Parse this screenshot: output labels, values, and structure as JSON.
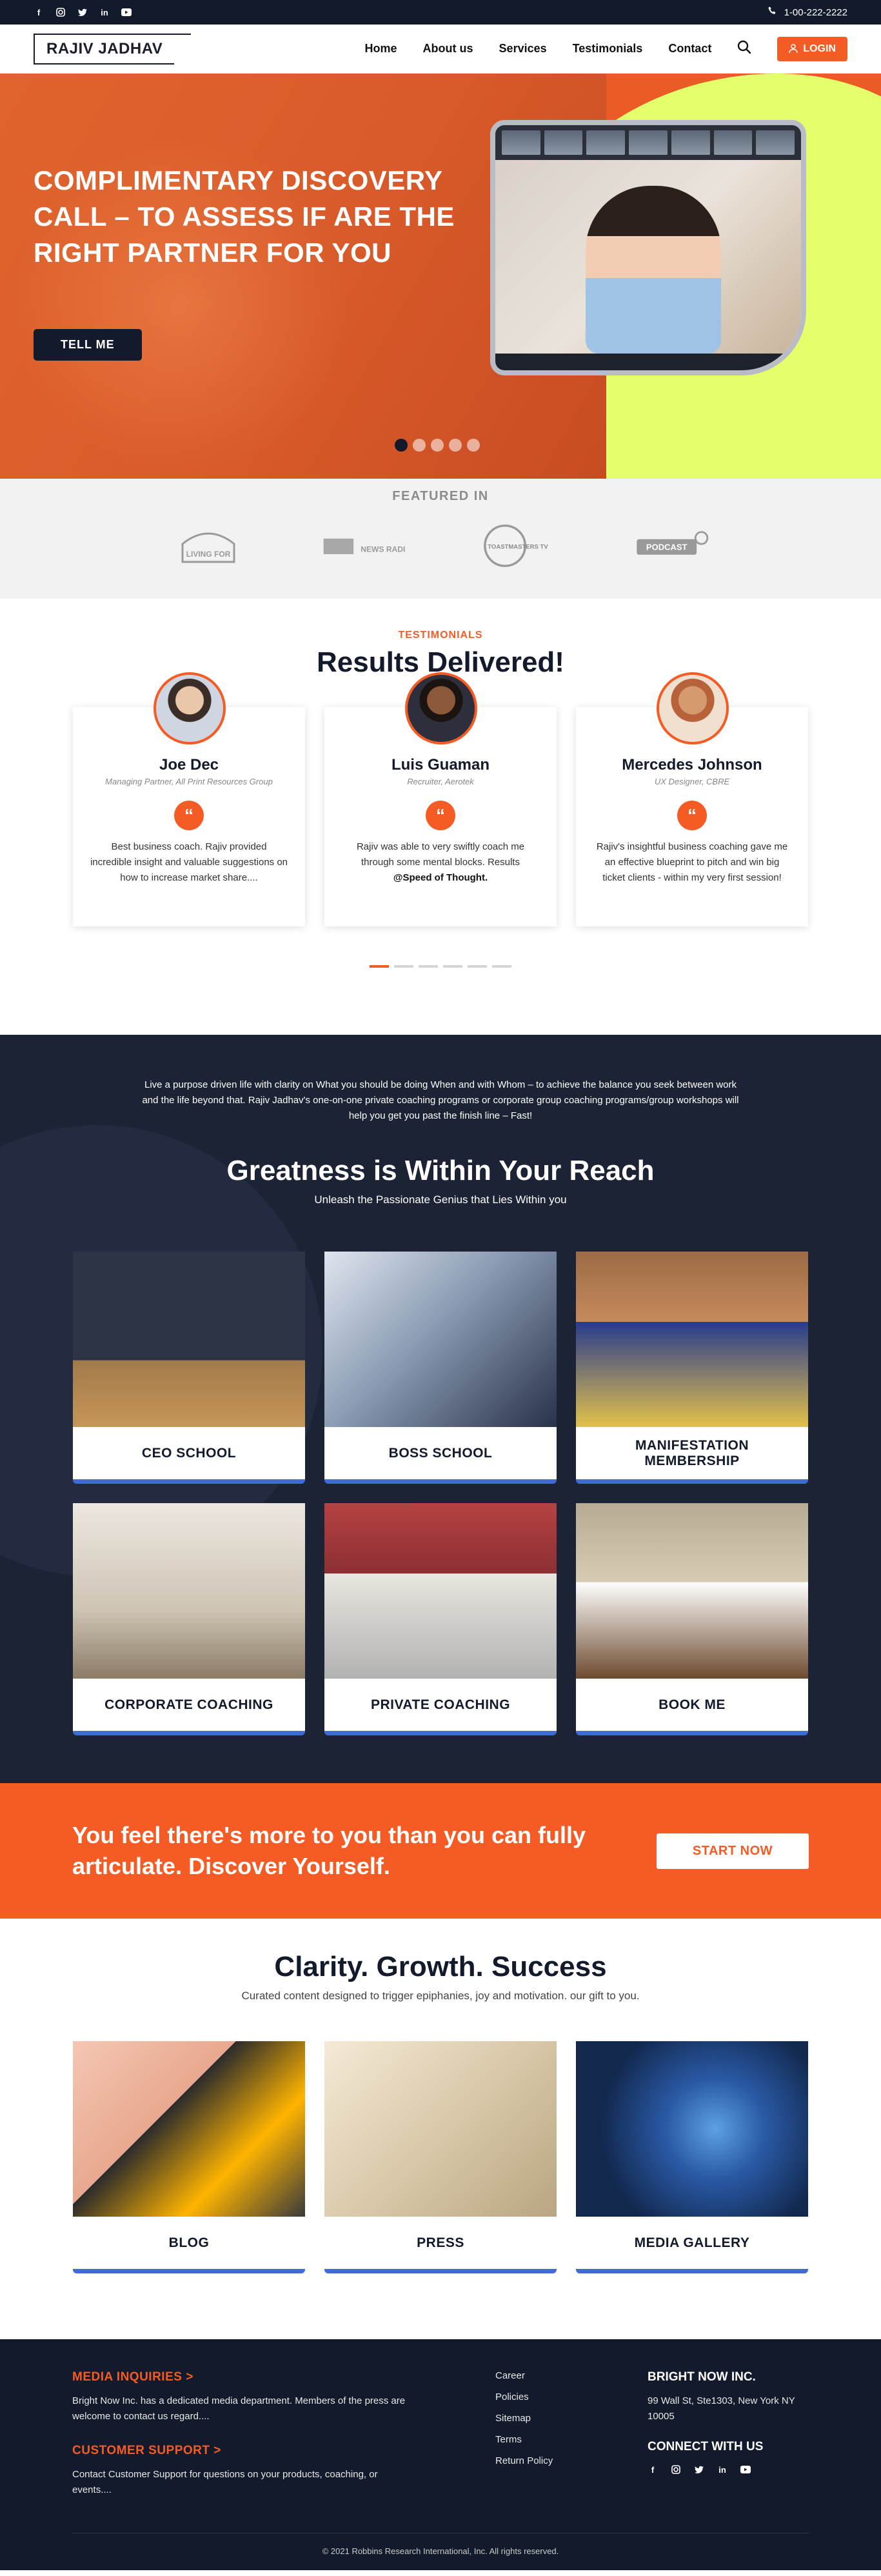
{
  "topbar": {
    "socials": [
      "facebook-icon",
      "instagram-icon",
      "twitter-icon",
      "linkedin-icon",
      "youtube-icon"
    ],
    "phone": "1-00-222-2222"
  },
  "header": {
    "logo": "RAJIV JADHAV",
    "nav": [
      "Home",
      "About us",
      "Services",
      "Testimonials",
      "Contact"
    ],
    "login": "LOGIN"
  },
  "hero": {
    "title": "COMPLIMENTARY DISCOVERY CALL – TO ASSESS IF ARE THE RIGHT PARTNER FOR YOU",
    "button": "TELL ME",
    "slides": 5,
    "active_slide": 1
  },
  "featured": {
    "title": "FEATURED IN",
    "logos": [
      "LIVING FOR",
      "NEWS RADIO",
      "TOASTMASTERS TV",
      "PODCAST"
    ]
  },
  "testimonials": {
    "eyebrow": "TESTIMONIALS",
    "title": "Results Delivered!",
    "items": [
      {
        "name": "Joe Dec",
        "role": "Managing Partner, All Print Resources Group",
        "text": "Best business coach. Rajiv provided incredible insight and valuable suggestions on how to increase market share...."
      },
      {
        "name": "Luis Guaman",
        "role": "Recruiter, Aerotek",
        "text": "Rajiv was able to very swiftly coach me through some mental blocks. Results",
        "bold": "@Speed of Thought."
      },
      {
        "name": "Mercedes Johnson",
        "role": "UX Designer, CBRE",
        "text": "Rajiv's insightful business coaching gave me an effective blueprint to pitch and win big ticket clients - within my very first session!"
      }
    ]
  },
  "greatness": {
    "intro": "Live a purpose driven life with clarity on What you should be doing When and with Whom – to achieve the balance you seek between work and the life beyond that. Rajiv Jadhav's one-on-one private coaching programs or corporate group coaching programs/group workshops will help you get you past the finish line – Fast!",
    "title": "Greatness is Within Your Reach",
    "subtitle": "Unleash the Passionate Genius that Lies Within you",
    "cards": [
      "CEO SCHOOL",
      "BOSS SCHOOL",
      "MANIFESTATION MEMBERSHIP",
      "CORPORATE COACHING",
      "PRIVATE COACHING",
      "BOOK ME"
    ]
  },
  "cta": {
    "text": "You feel there's more to you than you can fully articulate. Discover Yourself.",
    "button": "START NOW"
  },
  "clarity": {
    "title": "Clarity. Growth. Success",
    "subtitle": "Curated content designed to trigger epiphanies, joy and motivation. our gift to you.",
    "cards": [
      "BLOG",
      "PRESS",
      "MEDIA GALLERY"
    ]
  },
  "footer": {
    "media_title": "MEDIA INQUIRIES >",
    "media_text": "Bright Now Inc. has a dedicated media department. Members of the press are welcome to contact us regard....",
    "support_title": "CUSTOMER SUPPORT >",
    "support_text": "Contact Customer Support for questions on your products, coaching, or events....",
    "links": [
      "Career",
      "Policies",
      "Sitemap",
      "Terms",
      "Return Policy"
    ],
    "company": "BRIGHT NOW INC.",
    "address": "99 Wall St, Ste1303, New York NY 10005",
    "connect": "CONNECT WITH US",
    "copyright": "© 2021 Robbins Research International, Inc. All rights reserved."
  },
  "colors": {
    "accent": "#f45b25",
    "navy": "#121a2b",
    "lime": "#e3ff6b",
    "blue": "#3f6bd8"
  }
}
